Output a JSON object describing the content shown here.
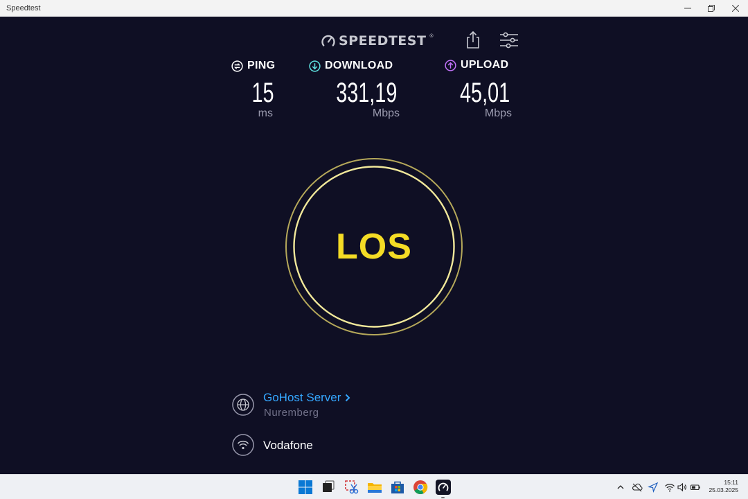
{
  "window": {
    "title": "Speedtest"
  },
  "header": {
    "logo_text": "SPEEDTEST",
    "logo_trademark": "®"
  },
  "metrics": {
    "ping": {
      "label": "PING",
      "value": "15",
      "unit": "ms"
    },
    "download": {
      "label": "DOWNLOAD",
      "value": "331,19",
      "unit": "Mbps"
    },
    "upload": {
      "label": "UPLOAD",
      "value": "45,01",
      "unit": "Mbps"
    }
  },
  "go_button": {
    "label": "LOS"
  },
  "server": {
    "name": "GoHost Server",
    "location": "Nuremberg"
  },
  "provider": {
    "name": "Vodafone"
  },
  "taskbar": {
    "apps": [
      "windows-start-icon",
      "task-view-icon",
      "snipping-tool-icon",
      "file-explorer-icon",
      "microsoft-store-icon",
      "chrome-icon",
      "speedtest-app-icon"
    ],
    "tray": [
      "chevron-up-icon",
      "onedrive-icon",
      "location-icon",
      "wifi-icon",
      "volume-icon",
      "battery-icon"
    ],
    "time": "15:11",
    "date": "25.03.2025"
  },
  "colors": {
    "background": "#0f0f24",
    "accent_yellow": "#f4dc25",
    "ping_icon": "#ffffff",
    "download_icon": "#5ee3e1",
    "upload_icon": "#bf71f6",
    "server_link": "#35a7ff"
  }
}
